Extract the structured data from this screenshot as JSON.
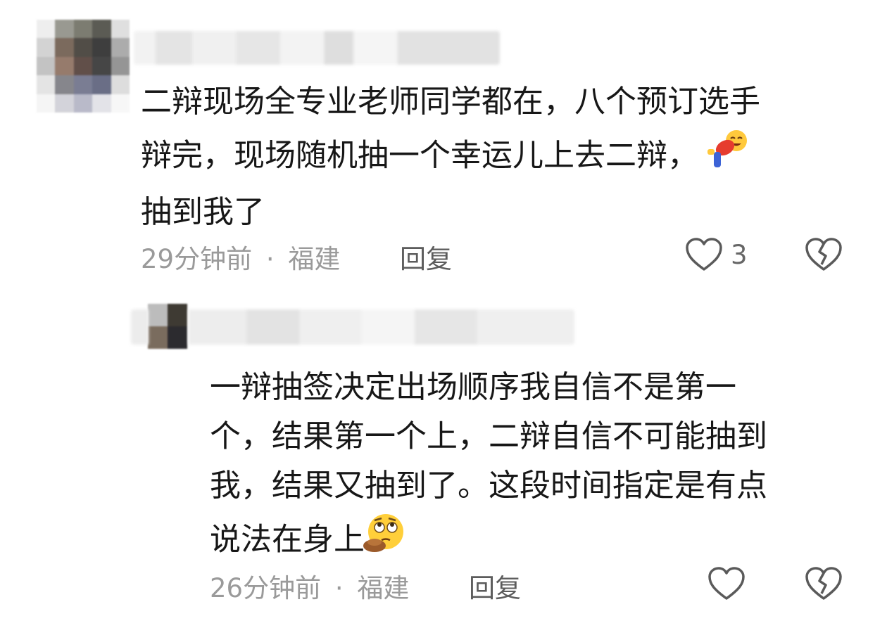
{
  "comments": [
    {
      "text_lines": [
        "二辩现场全专业老师同学都在，八个预订选手",
        "辩完，现场随机抽一个幸运儿上去二辩，",
        "抽到我了"
      ],
      "emoji": "bowing-laugh-emoji",
      "time": "29分钟前",
      "separator": "·",
      "location": "福建",
      "reply_label": "回复",
      "like_count": "3"
    },
    {
      "text_lines": [
        "一辩抽签决定出场顺序我自信不是第一",
        "个，结果第一个上，二辩自信不可能抽到",
        "我，结果又抽到了。这段时间指定是有点",
        "说法在身上"
      ],
      "emoji": "thinking-eyeroll-emoji",
      "time": "26分钟前",
      "separator": "·",
      "location": "福建",
      "reply_label": "回复",
      "like_count": ""
    }
  ],
  "icons": {
    "like": "heart-outline-icon",
    "dislike": "broken-heart-icon"
  },
  "colors": {
    "text": "#171717",
    "meta": "#9a9a9a",
    "icon": "#5a5a5a"
  }
}
